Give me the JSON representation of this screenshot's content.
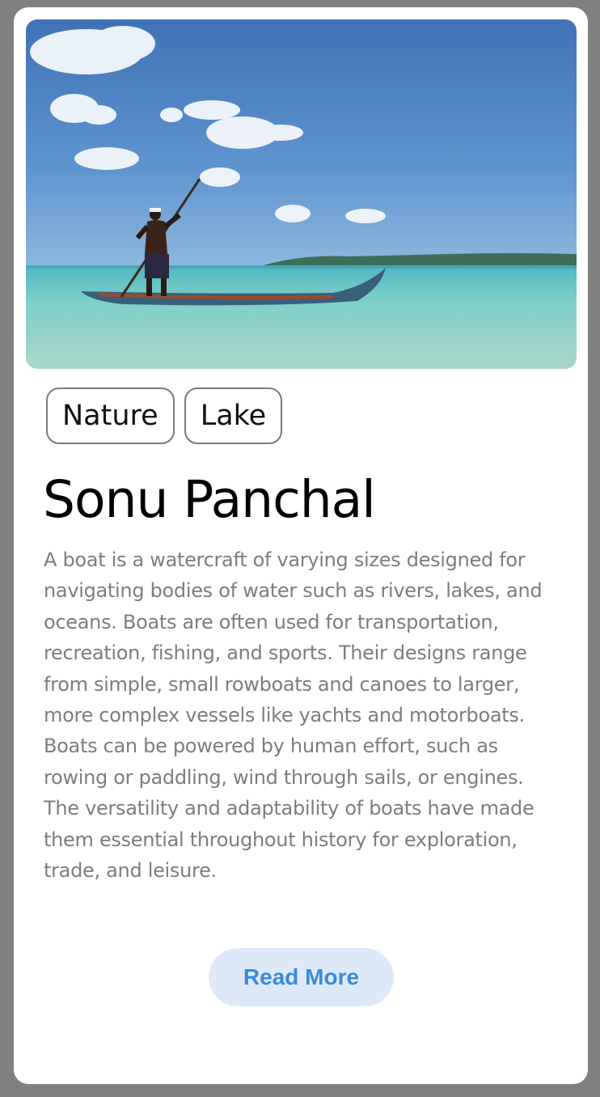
{
  "card": {
    "image_alt": "Man poling a wooden canoe on shallow turquoise water",
    "tags": [
      "Nature",
      "Lake"
    ],
    "title": "Sonu Panchal",
    "description": "A boat is a watercraft of varying sizes designed for navigating bodies of water such as rivers, lakes, and oceans. Boats are often used for transportation, recreation, fishing, and sports. Their designs range from simple, small rowboats and canoes to larger, more complex vessels like yachts and motorboats. Boats can be powered by human effort, such as rowing or paddling, wind through sails, or engines. The versatility and adaptability of boats have made them essential throughout history for exploration, trade, and leisure.",
    "read_more_label": "Read More"
  },
  "colors": {
    "page_background": "#808080",
    "card_background": "#ffffff",
    "button_background": "#dde9f8",
    "button_text": "#3b8ad9",
    "description_text": "#7d7d7d"
  }
}
